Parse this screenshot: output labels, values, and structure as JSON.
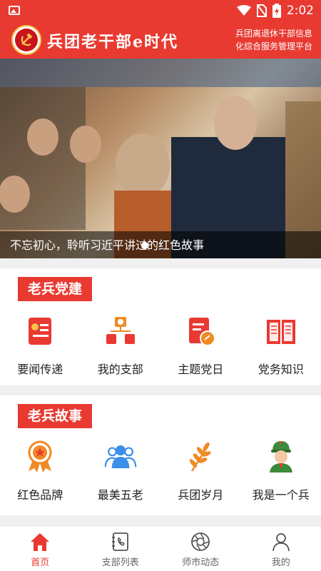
{
  "status": {
    "time": "2:02"
  },
  "header": {
    "title": "兵团老干部e时代",
    "subtitle_line1": "兵团离退休干部信息",
    "subtitle_line2": "化综合服务管理平台"
  },
  "banner": {
    "caption": "不忘初心，聆听习近平讲过的红色故事"
  },
  "sections": [
    {
      "title": "老兵党建",
      "items": [
        {
          "label": "要闻传递",
          "icon": "news-doc-icon"
        },
        {
          "label": "我的支部",
          "icon": "branch-org-icon"
        },
        {
          "label": "主题党日",
          "icon": "party-day-icon"
        },
        {
          "label": "党务知识",
          "icon": "book-icon"
        }
      ]
    },
    {
      "title": "老兵故事",
      "items": [
        {
          "label": "红色品牌",
          "icon": "medal-icon"
        },
        {
          "label": "最美五老",
          "icon": "people-icon"
        },
        {
          "label": "兵团岁月",
          "icon": "wheat-icon"
        },
        {
          "label": "我是一个兵",
          "icon": "soldier-icon"
        }
      ]
    }
  ],
  "tabs": [
    {
      "label": "首页",
      "icon": "home-icon",
      "active": true
    },
    {
      "label": "支部列表",
      "icon": "phone-book-icon",
      "active": false
    },
    {
      "label": "师市动态",
      "icon": "aperture-icon",
      "active": false
    },
    {
      "label": "我的",
      "icon": "person-icon",
      "active": false
    }
  ],
  "colors": {
    "brand": "#e83a31",
    "orange": "#f08a24",
    "blue": "#3b8fe8",
    "green": "#3d8a3a"
  }
}
